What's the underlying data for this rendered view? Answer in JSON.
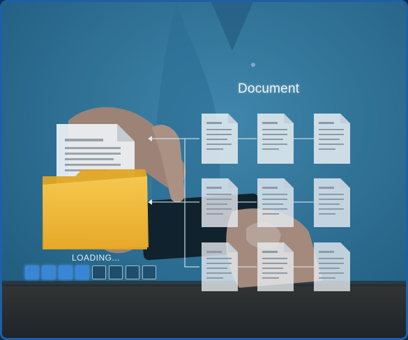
{
  "scene": {
    "title": "Document",
    "loading_text": "LOADING...",
    "progress": {
      "segments_total": 8,
      "segments_filled": 4
    },
    "icons": [
      "folder-icon",
      "document-icon"
    ]
  }
}
